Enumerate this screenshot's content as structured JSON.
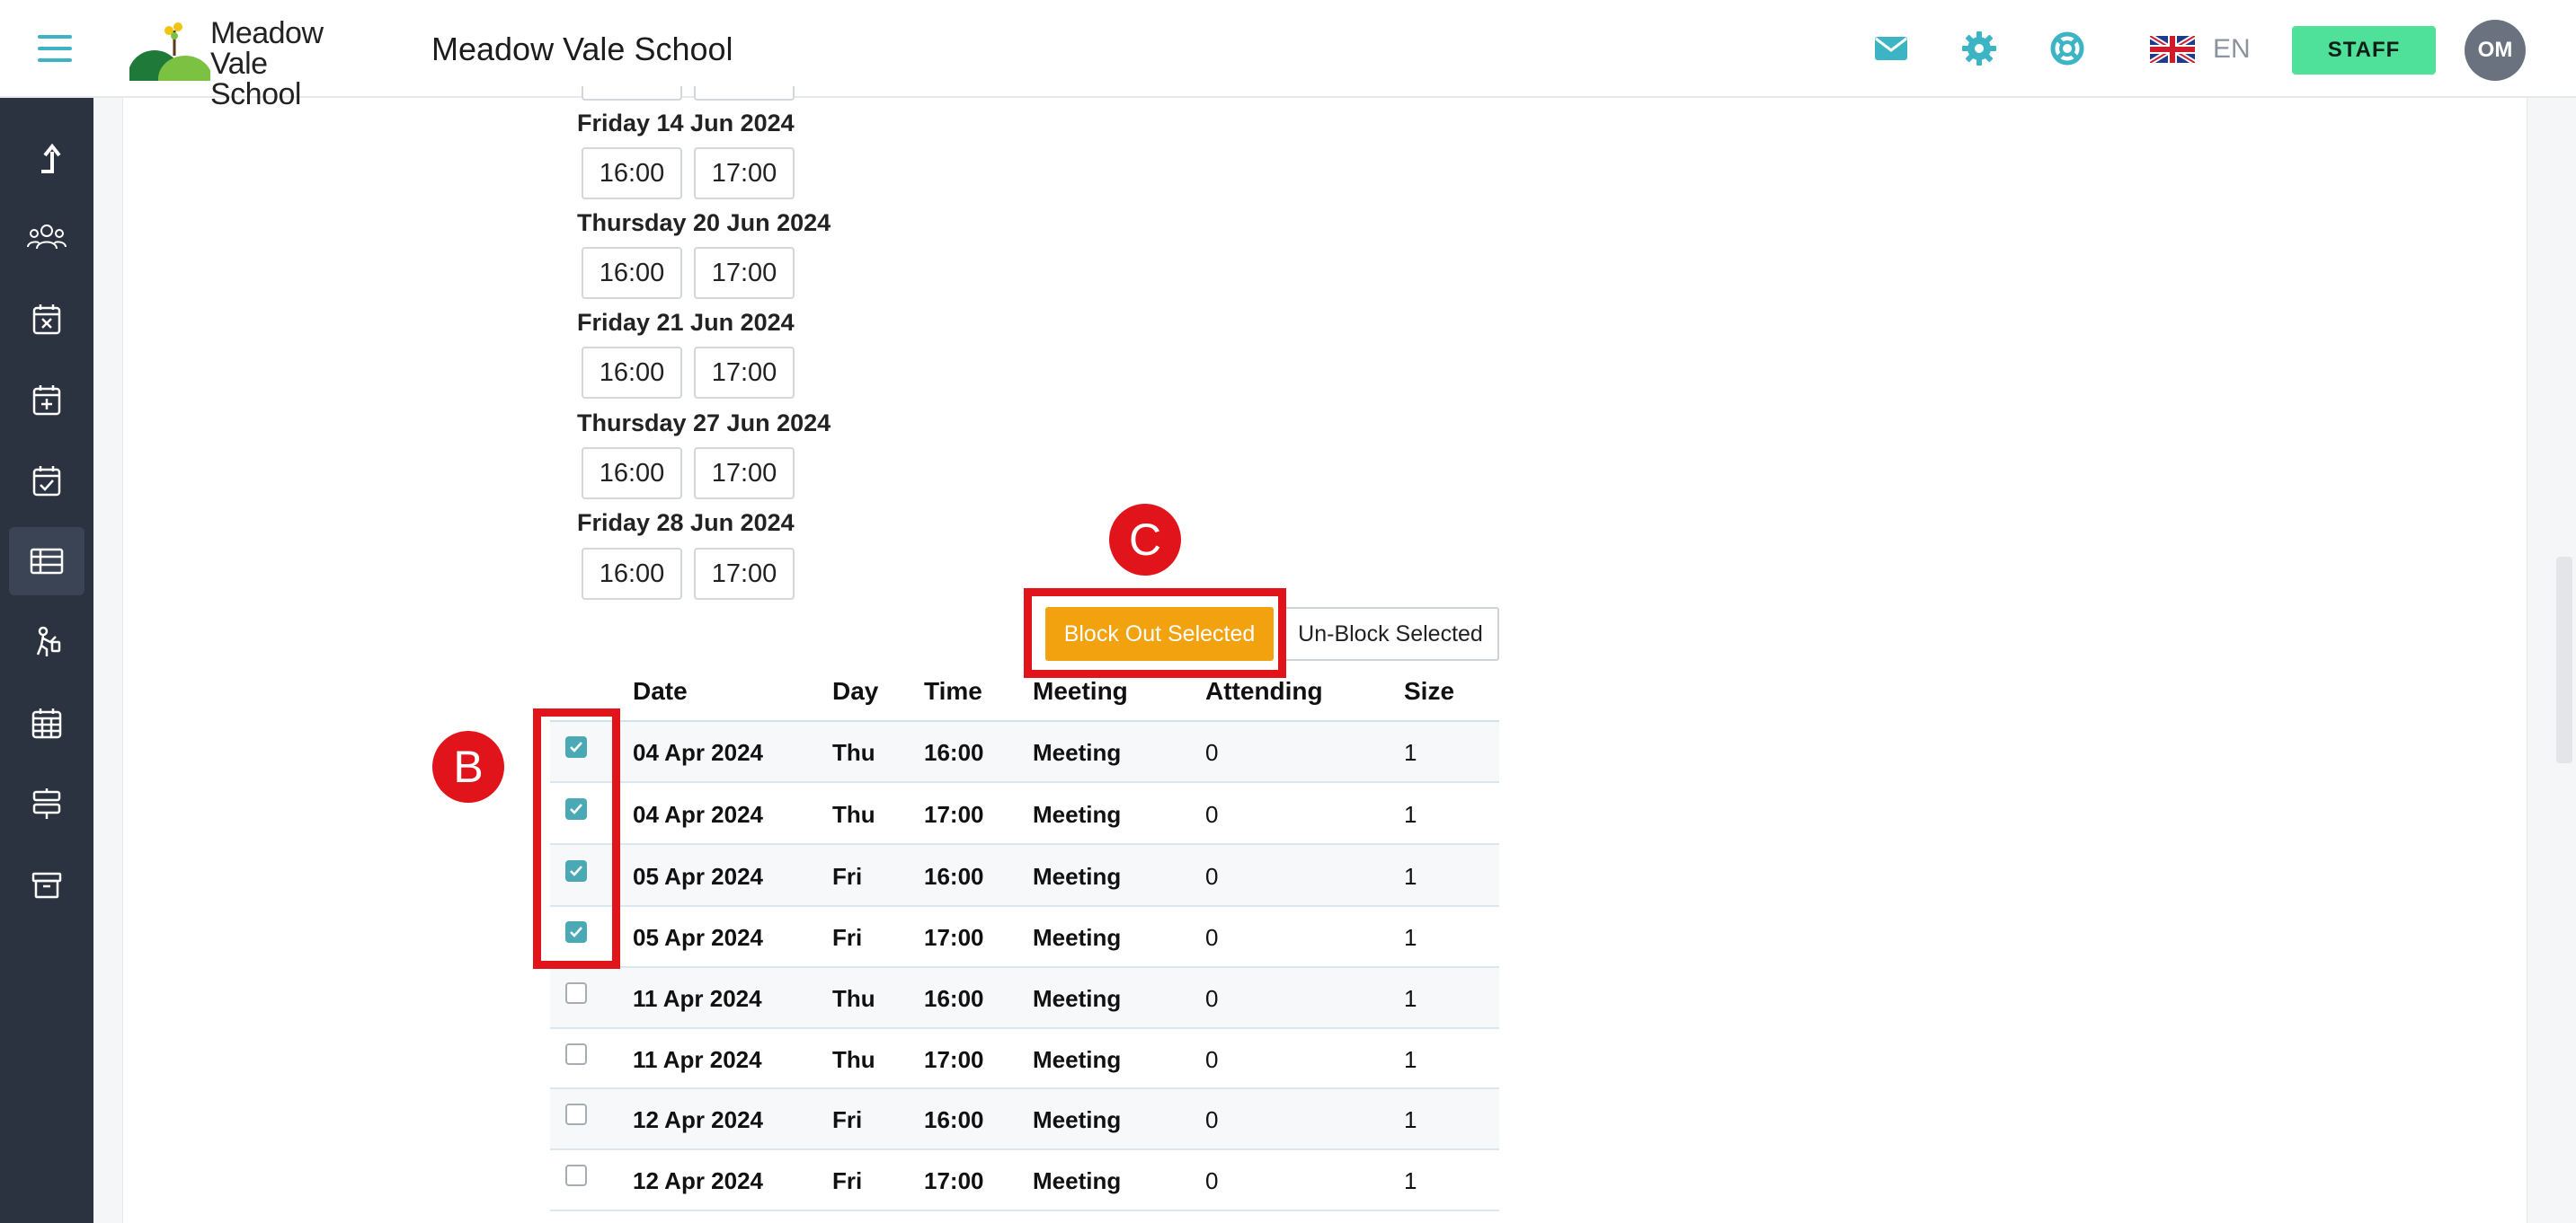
{
  "header": {
    "logo_text_line1": "Meadow",
    "logo_text_line2": "Vale School",
    "school_name": "Meadow Vale School",
    "icons": [
      "mail-icon",
      "gear-icon",
      "lifebuoy-icon"
    ],
    "language": "EN",
    "role_button": "STAFF",
    "avatar_initials": "OM"
  },
  "sidebar": {
    "items": [
      {
        "icon": "arrow-up-icon"
      },
      {
        "icon": "users-icon"
      },
      {
        "icon": "calendar-x-icon"
      },
      {
        "icon": "calendar-plus-icon"
      },
      {
        "icon": "calendar-check-icon"
      },
      {
        "icon": "table-icon",
        "active": true
      },
      {
        "icon": "person-walk-icon"
      },
      {
        "icon": "calendar-grid-icon"
      },
      {
        "icon": "signpost-icon"
      },
      {
        "icon": "archive-icon"
      }
    ]
  },
  "schedule": [
    {
      "date": "Friday 14 Jun 2024",
      "times": [
        "16:00",
        "17:00"
      ]
    },
    {
      "date": "Thursday 20 Jun 2024",
      "times": [
        "16:00",
        "17:00"
      ]
    },
    {
      "date": "Friday 21 Jun 2024",
      "times": [
        "16:00",
        "17:00"
      ]
    },
    {
      "date": "Thursday 27 Jun 2024",
      "times": [
        "16:00",
        "17:00"
      ]
    },
    {
      "date": "Friday 28 Jun 2024",
      "times": [
        "16:00",
        "17:00"
      ]
    }
  ],
  "actions": {
    "block_label": "Block Out Selected",
    "unblock_label": "Un-Block Selected"
  },
  "table": {
    "headers": [
      "Date",
      "Day",
      "Time",
      "Meeting",
      "Attending",
      "Size"
    ],
    "rows": [
      {
        "checked": true,
        "date": "04 Apr 2024",
        "day": "Thu",
        "time": "16:00",
        "meeting": "Meeting",
        "attending": "0",
        "size": "1"
      },
      {
        "checked": true,
        "date": "04 Apr 2024",
        "day": "Thu",
        "time": "17:00",
        "meeting": "Meeting",
        "attending": "0",
        "size": "1"
      },
      {
        "checked": true,
        "date": "05 Apr 2024",
        "day": "Fri",
        "time": "16:00",
        "meeting": "Meeting",
        "attending": "0",
        "size": "1"
      },
      {
        "checked": true,
        "date": "05 Apr 2024",
        "day": "Fri",
        "time": "17:00",
        "meeting": "Meeting",
        "attending": "0",
        "size": "1"
      },
      {
        "checked": false,
        "date": "11 Apr 2024",
        "day": "Thu",
        "time": "16:00",
        "meeting": "Meeting",
        "attending": "0",
        "size": "1"
      },
      {
        "checked": false,
        "date": "11 Apr 2024",
        "day": "Thu",
        "time": "17:00",
        "meeting": "Meeting",
        "attending": "0",
        "size": "1"
      },
      {
        "checked": false,
        "date": "12 Apr 2024",
        "day": "Fri",
        "time": "16:00",
        "meeting": "Meeting",
        "attending": "0",
        "size": "1"
      },
      {
        "checked": false,
        "date": "12 Apr 2024",
        "day": "Fri",
        "time": "17:00",
        "meeting": "Meeting",
        "attending": "0",
        "size": "1"
      }
    ]
  },
  "annotations": {
    "b_label": "B",
    "c_label": "C",
    "color": "#e1141b"
  }
}
